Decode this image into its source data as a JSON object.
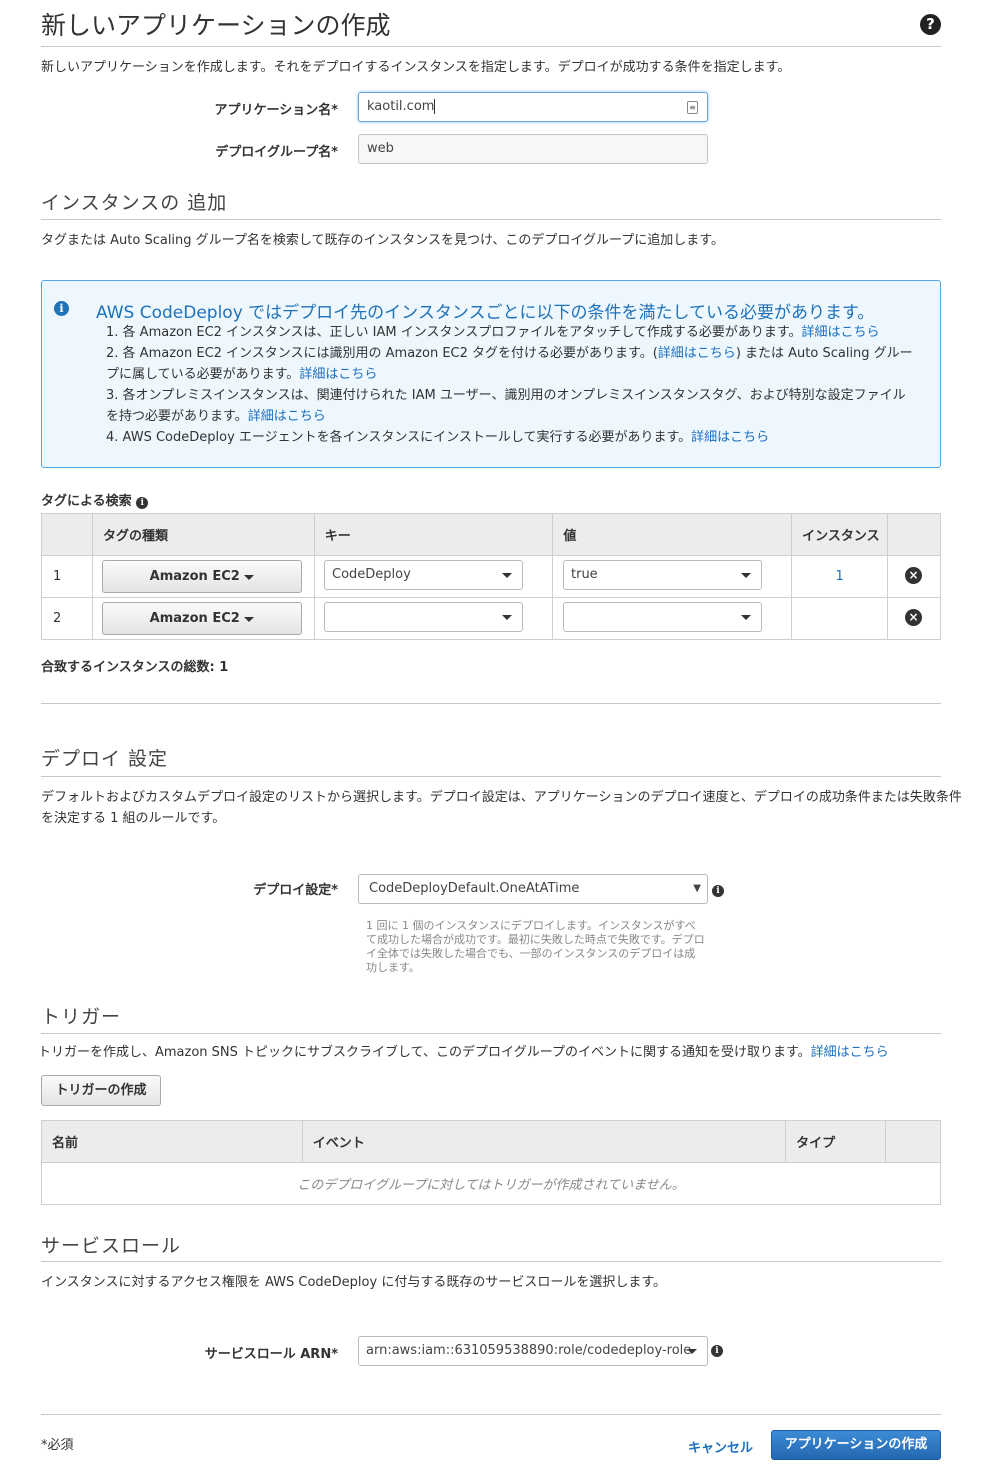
{
  "page": {
    "title": "新しいアプリケーションの作成",
    "description": "新しいアプリケーションを作成します。それをデプロイするインスタンスを指定します。デプロイが成功する条件を指定します。"
  },
  "form": {
    "app_name_label": "アプリケーション名*",
    "app_name_value": "kaotil.com",
    "group_name_label": "デプロイグループ名*",
    "group_name_value": "web"
  },
  "instances": {
    "title": "インスタンスの 追加",
    "description": "タグまたは Auto Scaling グループ名を検索して既存のインスタンスを見つけ、このデプロイグループに追加します。"
  },
  "info_box": {
    "title": "AWS CodeDeploy ではデプロイ先のインスタンスごとに以下の条件を満たしている必要があります。",
    "items": [
      {
        "num": "1.",
        "text": "各 Amazon EC2 インスタンスは、正しい IAM インスタンスプロファイルをアタッチして作成する必要があります。",
        "link": "詳細はこちら"
      },
      {
        "num": "2.",
        "text_a": "各 Amazon EC2 インスタンスには識別用の Amazon EC2 タグを付ける必要があります。(",
        "link_a": "詳細はこちら",
        "text_b": ") または Auto Scaling グループに属している必要があります。",
        "link_b": "詳細はこちら"
      },
      {
        "num": "3.",
        "text": "各オンプレミスインスタンスは、関連付けられた IAM ユーザー、識別用のオンプレミスインスタンスタグ、および特別な設定ファイルを持つ必要があります。",
        "link": "詳細はこちら"
      },
      {
        "num": "4.",
        "text": "AWS CodeDeploy エージェントを各インスタンスにインストールして実行する必要があります。",
        "link": "詳細はこちら"
      }
    ]
  },
  "tag_search": {
    "label": "タグによる検索",
    "headers": [
      "",
      "タグの種類",
      "キー",
      "値",
      "インスタンス",
      ""
    ],
    "rows": [
      {
        "index": "1",
        "type": "Amazon EC2",
        "key": "CodeDeploy",
        "value": "true",
        "instances": "1"
      },
      {
        "index": "2",
        "type": "Amazon EC2",
        "key": "",
        "value": "",
        "instances": ""
      }
    ],
    "total": "合致するインスタンスの総数: 1"
  },
  "deploy_config": {
    "title": "デプロイ 設定",
    "description_line1": "デフォルトおよびカスタムデプロイ設定のリストから選択します。デプロイ設定は、アプリケーションのデプロイ速度と、デプロイの成功条件または失敗条件",
    "description_line2": "を決定する 1 組のルールです。",
    "label": "デプロイ設定*",
    "value": "CodeDeployDefault.OneAtATime",
    "hint": "1 回に 1 個のインスタンスにデプロイします。インスタンスがすべて成功した場合が成功です。最初に失敗した時点で失敗です。デプロイ全体では失敗した場合でも、一部のインスタンスのデプロイは成功します。"
  },
  "triggers": {
    "title": "トリガー",
    "description": "トリガーを作成し、Amazon SNS トピックにサブスクライブして、このデプロイグループのイベントに関する通知を受け取ります。",
    "link": "詳細はこちら",
    "create_button": "トリガーの作成",
    "headers": [
      "名前",
      "イベント",
      "タイプ",
      ""
    ],
    "empty": "このデプロイグループに対してはトリガーが作成されていません。"
  },
  "service_role": {
    "title": "サービスロール",
    "description": "インスタンスに対するアクセス権限を AWS CodeDeploy に付与する既存のサービスロールを選択します。",
    "label": "サービスロール ARN*",
    "value": "arn:aws:iam::631059538890:role/codedeploy-role"
  },
  "footer": {
    "required_note": "*必須",
    "cancel": "キャンセル",
    "create": "アプリケーションの作成"
  },
  "icons": {
    "help": "?",
    "info": "i",
    "remove": "×"
  }
}
